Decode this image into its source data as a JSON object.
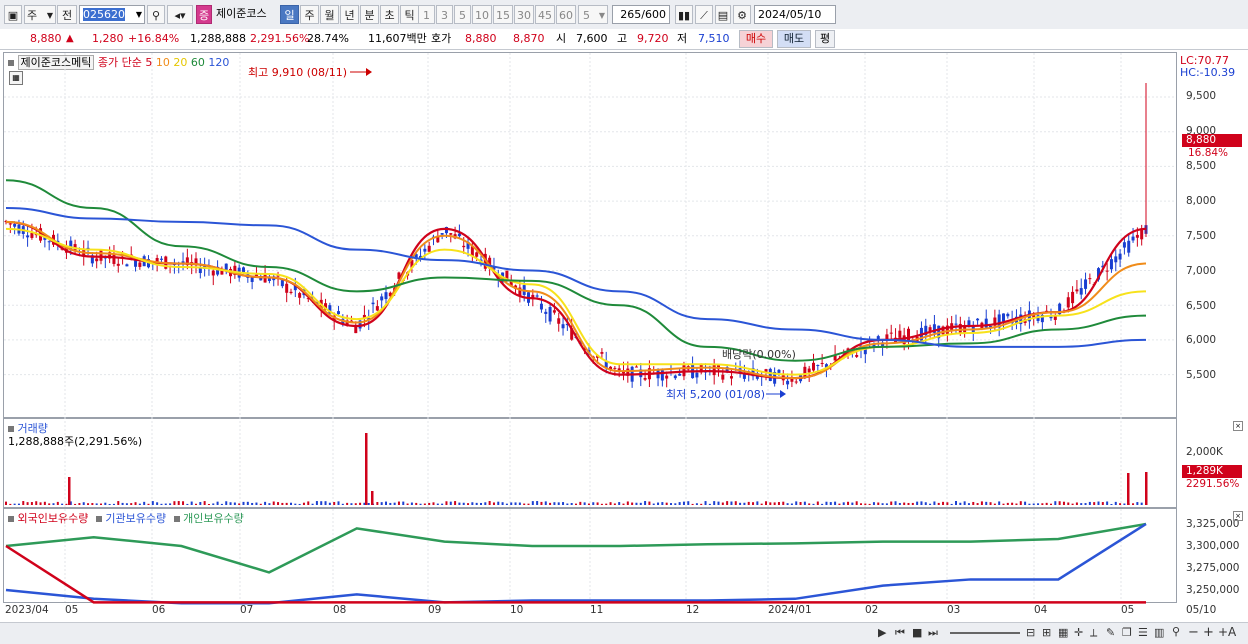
{
  "toolbar": {
    "market_select": "주",
    "code_label": "전",
    "stock_code": "025620",
    "search_icon": "search-icon",
    "type_badge": "증",
    "stock_name": "제이준코스",
    "periods": [
      "일",
      "주",
      "월",
      "년",
      "분",
      "초",
      "틱"
    ],
    "active_period": "일",
    "intervals": [
      "1",
      "3",
      "5",
      "10",
      "15",
      "30",
      "45",
      "60"
    ],
    "interval_select": "5",
    "count": "265",
    "count_total": "/600",
    "date": "2024/05/10"
  },
  "quote": {
    "price": "8,880",
    "arrow": "▲",
    "change": "1,280",
    "change_pct": "+16.84%",
    "volume": "1,288,888",
    "volume_pct": "2,291.56%",
    "turnover_pct": "28.74%",
    "amount": "11,607백만",
    "hoga_label": "호가",
    "ask": "8,880",
    "bid": "8,870",
    "open_label": "시",
    "open": "7,600",
    "high_label": "고",
    "high": "9,720",
    "low_label": "저",
    "low": "7,510",
    "buy_label": "매수",
    "sell_label": "매도",
    "eval_label": "평"
  },
  "price_pane": {
    "stock_tag": "제이준코스메틱",
    "ma_title": "종가 단순",
    "ma_periods": [
      "5",
      "10",
      "20",
      "60",
      "120"
    ],
    "high_annotation": "최고 9,910 (08/11)",
    "low_annotation": "최저 5,200 (01/08)",
    "dividend_annotation": "배당락(0.00%)",
    "lc": "LC:70.77",
    "hc": "HC:-10.39",
    "y_ticks": [
      "9,500",
      "9,000",
      "8,500",
      "8,000",
      "7,500",
      "7,000",
      "6,500",
      "6,000",
      "5,500"
    ],
    "current_price": "8,880",
    "current_pct": "16.84%"
  },
  "volume_pane": {
    "title": "거래량",
    "value": "1,288,888주(2,291.56%)",
    "y_tick": "2,000K",
    "current": "1,289K",
    "current_pct": "2291.56%"
  },
  "holding_pane": {
    "legend": [
      "외국인보유수량",
      "기관보유수량",
      "개인보유수량"
    ],
    "y_ticks": [
      "3,325,000",
      "3,300,000",
      "3,275,000",
      "3,250,000"
    ]
  },
  "x_axis": [
    "2023/04",
    "05",
    "06",
    "07",
    "08",
    "09",
    "10",
    "11",
    "12",
    "2024/01",
    "02",
    "03",
    "04",
    "05",
    "05/10"
  ],
  "colors": {
    "up": "#d0021b",
    "down": "#1a3fd1",
    "ma5": "#d0021b",
    "ma10": "#f08c1a",
    "ma20": "#f7e21b",
    "ma60": "#1f8a3a",
    "ma120": "#2b55d6",
    "foreign": "#d0021b",
    "institution": "#2b55d6",
    "individual": "#2e9a58"
  },
  "chart_data": {
    "type": "line",
    "title": "",
    "x": [
      "2023/04",
      "05",
      "06",
      "07",
      "08",
      "09",
      "10",
      "11",
      "12",
      "2024/01",
      "02",
      "03",
      "04",
      "05"
    ],
    "series": [
      {
        "name": "5",
        "values": [
          7700,
          7200,
          7100,
          6900,
          6200,
          7600,
          6600,
          5500,
          5550,
          5450,
          6000,
          6200,
          6400,
          7600
        ]
      },
      {
        "name": "10",
        "values": [
          7700,
          7250,
          7100,
          6900,
          6250,
          7500,
          6700,
          5550,
          5600,
          5450,
          5950,
          6150,
          6400,
          7100
        ]
      },
      {
        "name": "20",
        "values": [
          7600,
          7300,
          7050,
          6950,
          6300,
          7300,
          6800,
          5650,
          5650,
          5500,
          5900,
          6100,
          6350,
          6700
        ]
      },
      {
        "name": "60",
        "values": [
          8300,
          7900,
          7350,
          7050,
          6700,
          6900,
          6850,
          6500,
          5900,
          5700,
          5900,
          5950,
          6150,
          6350
        ]
      },
      {
        "name": "120",
        "values": [
          7900,
          7750,
          7700,
          7650,
          7300,
          7150,
          7000,
          6700,
          6300,
          6150,
          6000,
          5900,
          5900,
          6000
        ]
      }
    ],
    "ylim": [
      5100,
      9750
    ]
  }
}
